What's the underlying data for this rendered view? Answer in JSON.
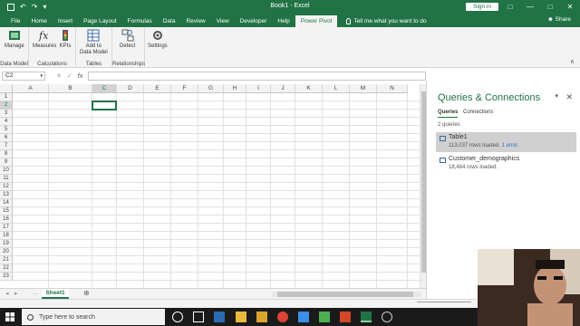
{
  "window": {
    "title": "Book1 - Excel",
    "signin_label": "Sign in",
    "qat": {
      "save": "💾",
      "undo": "↶",
      "redo": "↷",
      "customize": "▾"
    },
    "controls": {
      "restore": "□",
      "minimize": "—",
      "maximize": "□",
      "close": "✕"
    }
  },
  "ribbon": {
    "tabs": [
      "File",
      "Home",
      "Insert",
      "Page Layout",
      "Formulas",
      "Data",
      "Review",
      "View",
      "Developer",
      "Help",
      "Power Pivot"
    ],
    "active_tab": "Power Pivot",
    "tell_me": "Tell me what you want to do",
    "share": "Share",
    "groups": {
      "data_model": {
        "label": "Data Model",
        "buttons": [
          "Manage"
        ]
      },
      "calculations": {
        "label": "Calculations",
        "buttons": [
          "Measures",
          "KPIs"
        ]
      },
      "tables": {
        "label": "Tables",
        "buttons": [
          "Add to\nData Model"
        ]
      },
      "relationships": {
        "label": "Relationships",
        "buttons": [
          "Detect"
        ]
      },
      "settings": {
        "label": "",
        "buttons": [
          "Settings"
        ]
      }
    },
    "collapse": "∧"
  },
  "formula_bar": {
    "name_box": "C2",
    "cancel": "✕",
    "enter": "✓",
    "fx": "fx",
    "value": ""
  },
  "grid": {
    "columns": [
      "A",
      "B",
      "C",
      "D",
      "E",
      "F",
      "G",
      "H",
      "I",
      "J",
      "K",
      "L",
      "M",
      "N"
    ],
    "rows": [
      "1",
      "2",
      "3",
      "4",
      "5",
      "6",
      "7",
      "8",
      "9",
      "10",
      "11",
      "12",
      "13",
      "14",
      "15",
      "16",
      "17",
      "18",
      "19",
      "20",
      "21",
      "22",
      "23"
    ],
    "active_cell": "C2"
  },
  "sheets": {
    "tabs": [
      "Sheet1"
    ],
    "active": "Sheet1",
    "add": "⊕",
    "nav_prev": "◂",
    "nav_next": "▸",
    "ellipsis": "..."
  },
  "queries_pane": {
    "title": "Queries & Connections",
    "tabs": [
      "Queries",
      "Connections"
    ],
    "active_tab": "Queries",
    "count": "2 queries",
    "items": [
      {
        "name": "Table1",
        "status": "113,037 rows loaded.",
        "error": "1 error."
      },
      {
        "name": "Customer_demographics",
        "status": "18,484 rows loaded.",
        "error": ""
      }
    ]
  },
  "taskbar": {
    "search_placeholder": "Type here to search"
  },
  "colors": {
    "excel_green": "#217346",
    "selection_gray": "#d0d0d0",
    "error_link": "#2f6fc0"
  }
}
